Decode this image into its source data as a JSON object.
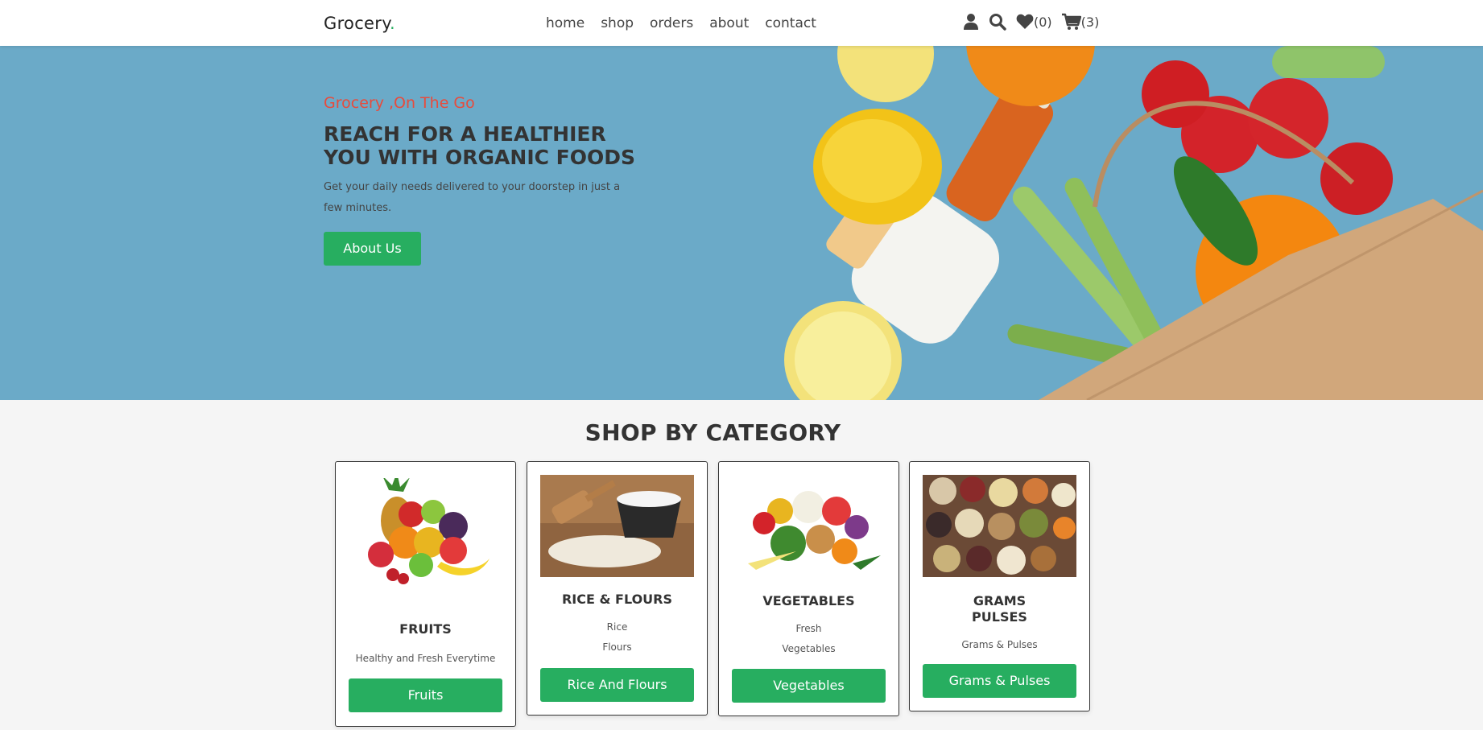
{
  "header": {
    "logo_text": "Grocery",
    "logo_dot": ".",
    "nav": [
      "home",
      "shop",
      "orders",
      "about",
      "contact"
    ],
    "wishlist_count": "(0)",
    "cart_count": "(3)"
  },
  "hero": {
    "subtitle": "Grocery ,On The Go",
    "title": "REACH FOR A HEALTHIER YOU WITH ORGANIC FOODS",
    "description": "Get your daily needs delivered to your doorstep in just a few minutes.",
    "button_label": "About Us"
  },
  "category": {
    "title": "SHOP BY CATEGORY",
    "cards": [
      {
        "title": "FRUITS",
        "desc": [
          "Healthy and Fresh Everytime"
        ],
        "button": "Fruits"
      },
      {
        "title": "RICE & FLOURS",
        "desc": [
          "Rice",
          "Flours"
        ],
        "button": "Rice And Flours"
      },
      {
        "title": "VEGETABLES",
        "desc": [
          "Fresh",
          "Vegetables"
        ],
        "button": "Vegetables"
      },
      {
        "title_lines": [
          "GRAMS",
          "PULSES"
        ],
        "desc": [
          "Grams & Pulses"
        ],
        "button": "Grams & Pulses"
      }
    ]
  },
  "colors": {
    "accent": "#27ae60",
    "hero_bg": "#6baac8",
    "subtitle": "#e84b3c"
  },
  "icons": [
    "user-icon",
    "search-icon",
    "heart-icon",
    "cart-icon"
  ]
}
